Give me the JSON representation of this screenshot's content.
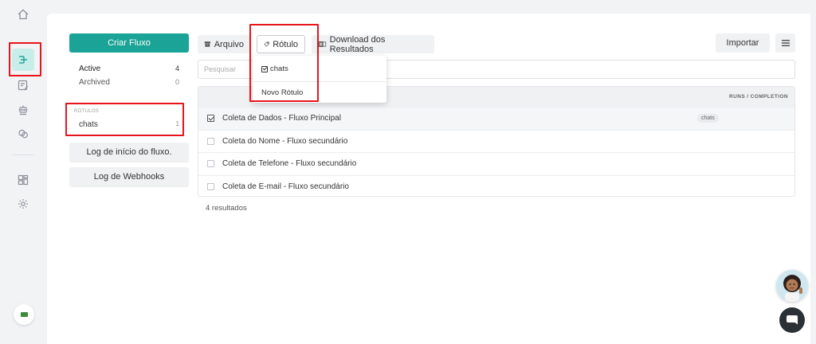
{
  "sidebar": {
    "icons": [
      "home-icon",
      "flows-icon",
      "edit-icon",
      "robot-icon",
      "chat-bubbles-icon",
      "dashboard-icon",
      "settings-icon"
    ]
  },
  "left": {
    "create_button": "Criar Fluxo",
    "statuses": [
      {
        "label": "Active",
        "count": "4"
      },
      {
        "label": "Archived",
        "count": "0"
      }
    ],
    "labels_title": "RÓTULOS",
    "labels": [
      {
        "label": "chats",
        "count": "1"
      }
    ],
    "start_log_button": "Log de início do fluxo.",
    "webhook_log_button": "Log de Webhooks"
  },
  "toolbar": {
    "archive_label": "Arquivo",
    "label_label": "Rótulo",
    "download_label": "Download dos Resultados",
    "import_label": "Importar"
  },
  "search": {
    "placeholder": "Pesquisar"
  },
  "dropdown": {
    "items": [
      {
        "label": "chats",
        "checked": true
      }
    ],
    "new_label": "Novo Rótulo"
  },
  "table": {
    "header_right": "RUNS / COMPLETION",
    "rows": [
      {
        "name": "Coleta de Dados - Fluxo Principal",
        "checked": true,
        "tag": "chats"
      },
      {
        "name": "Coleta do Nome - Fluxo secundário",
        "checked": false,
        "tag": ""
      },
      {
        "name": "Coleta de Telefone - Fluxo secundário",
        "checked": false,
        "tag": ""
      },
      {
        "name": "Coleta de E-mail - Fluxo secundário",
        "checked": false,
        "tag": ""
      }
    ]
  },
  "results_count": "4 resultados",
  "colors": {
    "accent": "#1ba397",
    "highlight": "#e8141c",
    "chat_fab": "#2b3036"
  }
}
